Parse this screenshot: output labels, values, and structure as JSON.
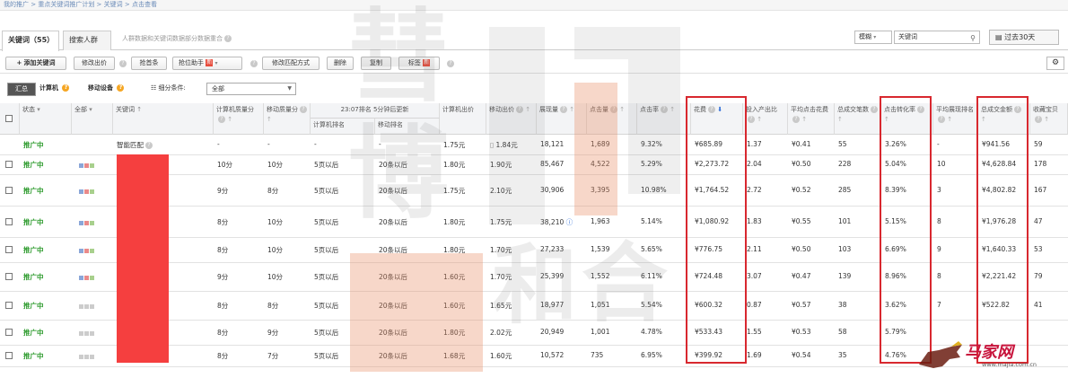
{
  "breadcrumb": "我的推广 > 重点关键词推广计划 > 关键词 > 点击查看",
  "tabs": [
    {
      "label": "关键词（55）",
      "active": true
    },
    {
      "label": "搜索人群",
      "active": false
    }
  ],
  "tab_note": "人群数据和关键词数据部分数据重合",
  "match_select": "模糊",
  "search": {
    "value": "关键词",
    "icon": "search-icon"
  },
  "period": "过去30天",
  "toolbar": {
    "add_keyword": "添加关键词",
    "edit_bid": "修改出价",
    "grab_first": "抢首条",
    "grab_helper": "抢位助手",
    "new_badge": "新",
    "edit_match": "修改匹配方式",
    "delete": "删除",
    "copy": "复制",
    "tag": "标签"
  },
  "filter": {
    "summary": "汇总",
    "computer": "计算机",
    "mobile": "移动设备",
    "segment_label": "细分条件:",
    "segment_value": "全部"
  },
  "headers": {
    "status": "状态",
    "all": "全部",
    "keyword": "关键词",
    "pc_quality": "计算机质量分",
    "mobile_quality": "移动质量分",
    "rank_time": "23:07排名",
    "rank_update": "5分钟后更新",
    "pc_rank": "计算机排名",
    "mobile_rank": "移动排名",
    "pc_bid": "计算机出价",
    "mobile_bid": "移动出价",
    "impressions": "展现量",
    "clicks": "点击量",
    "ctr": "点击率",
    "cost": "花费",
    "roi": "投入产出比",
    "avg_cpc": "平均点击花费",
    "transactions": "总成交笔数",
    "cvr": "点击转化率",
    "avg_rank": "平均展现排名",
    "revenue": "总成交金额",
    "fav": "收藏宝贝"
  },
  "rows": [
    {
      "status": "推广中",
      "keyword": "智能匹配",
      "pc_quality": "-",
      "mobile_quality": "-",
      "pc_rank": "-",
      "mobile_rank": "-",
      "pc_bid": "1.75元",
      "mobile_bid": "1.84元",
      "impressions": "18,121",
      "clicks": "1,689",
      "ctr": "9.32%",
      "cost": "¥685.89",
      "roi": "1.37",
      "avg_cpc": "¥0.41",
      "transactions": "55",
      "cvr": "3.26%",
      "avg_rank": "-",
      "revenue": "¥941.56",
      "fav": "59"
    },
    {
      "status": "推广中",
      "keyword": "",
      "pc_quality": "10分",
      "mobile_quality": "10分",
      "pc_rank": "5页以后",
      "mobile_rank": "20条以后",
      "pc_bid": "1.80元",
      "mobile_bid": "1.90元",
      "impressions": "85,467",
      "clicks": "4,522",
      "ctr": "5.29%",
      "cost": "¥2,273.72",
      "roi": "2.04",
      "avg_cpc": "¥0.50",
      "transactions": "228",
      "cvr": "5.04%",
      "avg_rank": "10",
      "revenue": "¥4,628.84",
      "fav": "178"
    },
    {
      "status": "推广中",
      "keyword": "",
      "pc_quality": "9分",
      "mobile_quality": "8分",
      "pc_rank": "5页以后",
      "mobile_rank": "20条以后",
      "pc_bid": "1.75元",
      "mobile_bid": "2.10元",
      "impressions": "30,906",
      "clicks": "3,395",
      "ctr": "10.98%",
      "cost": "¥1,764.52",
      "roi": "2.72",
      "avg_cpc": "¥0.52",
      "transactions": "285",
      "cvr": "8.39%",
      "avg_rank": "3",
      "revenue": "¥4,802.82",
      "fav": "167"
    },
    {
      "status": "推广中",
      "keyword": "",
      "pc_quality": "8分",
      "mobile_quality": "10分",
      "pc_rank": "5页以后",
      "mobile_rank": "20条以后",
      "pc_bid": "1.80元",
      "mobile_bid": "1.75元",
      "impressions": "38,210",
      "clicks": "1,963",
      "ctr": "5.14%",
      "cost": "¥1,080.92",
      "roi": "1.83",
      "avg_cpc": "¥0.55",
      "transactions": "101",
      "cvr": "5.15%",
      "avg_rank": "8",
      "revenue": "¥1,976.28",
      "fav": "47"
    },
    {
      "status": "推广中",
      "keyword": "",
      "pc_quality": "8分",
      "mobile_quality": "10分",
      "pc_rank": "5页以后",
      "mobile_rank": "20条以后",
      "pc_bid": "1.80元",
      "mobile_bid": "1.70元",
      "impressions": "27,233",
      "clicks": "1,539",
      "ctr": "5.65%",
      "cost": "¥776.75",
      "roi": "2.11",
      "avg_cpc": "¥0.50",
      "transactions": "103",
      "cvr": "6.69%",
      "avg_rank": "9",
      "revenue": "¥1,640.33",
      "fav": "53"
    },
    {
      "status": "推广中",
      "keyword": "",
      "pc_quality": "9分",
      "mobile_quality": "10分",
      "pc_rank": "5页以后",
      "mobile_rank": "20条以后",
      "pc_bid": "1.60元",
      "mobile_bid": "1.70元",
      "impressions": "25,399",
      "clicks": "1,552",
      "ctr": "6.11%",
      "cost": "¥724.48",
      "roi": "3.07",
      "avg_cpc": "¥0.47",
      "transactions": "139",
      "cvr": "8.96%",
      "avg_rank": "8",
      "revenue": "¥2,221.42",
      "fav": "79"
    },
    {
      "status": "推广中",
      "keyword": "",
      "pc_quality": "8分",
      "mobile_quality": "8分",
      "pc_rank": "5页以后",
      "mobile_rank": "20条以后",
      "pc_bid": "1.60元",
      "mobile_bid": "1.65元",
      "impressions": "18,977",
      "clicks": "1,051",
      "ctr": "5.54%",
      "cost": "¥600.32",
      "roi": "0.87",
      "avg_cpc": "¥0.57",
      "transactions": "38",
      "cvr": "3.62%",
      "avg_rank": "7",
      "revenue": "¥522.82",
      "fav": "41"
    },
    {
      "status": "推广中",
      "keyword": "",
      "pc_quality": "8分",
      "mobile_quality": "9分",
      "pc_rank": "5页以后",
      "mobile_rank": "20条以后",
      "pc_bid": "1.80元",
      "mobile_bid": "2.02元",
      "impressions": "20,949",
      "clicks": "1,001",
      "ctr": "4.78%",
      "cost": "¥533.43",
      "roi": "1.55",
      "avg_cpc": "¥0.53",
      "transactions": "58",
      "cvr": "5.79%",
      "avg_rank": "",
      "revenue": "",
      "fav": ""
    },
    {
      "status": "推广中",
      "keyword": "",
      "pc_quality": "8分",
      "mobile_quality": "7分",
      "pc_rank": "5页以后",
      "mobile_rank": "20条以后",
      "pc_bid": "1.68元",
      "mobile_bid": "1.60元",
      "impressions": "10,572",
      "clicks": "735",
      "ctr": "6.95%",
      "cost": "¥399.92",
      "roi": "1.69",
      "avg_cpc": "¥0.54",
      "transactions": "35",
      "cvr": "4.76%",
      "avg_rank": "",
      "revenue": "",
      "fav": ""
    }
  ],
  "watermark": {
    "chars": [
      "彗",
      "博",
      "和",
      "合"
    ]
  },
  "logo": {
    "name": "马家网",
    "url": "www.majia.com.cn"
  },
  "colors": {
    "status_green": "#2e9b2e",
    "highlight_red": "#d8282f",
    "mask_red": "#f53f3f",
    "new_badge": "#e74c3c"
  }
}
